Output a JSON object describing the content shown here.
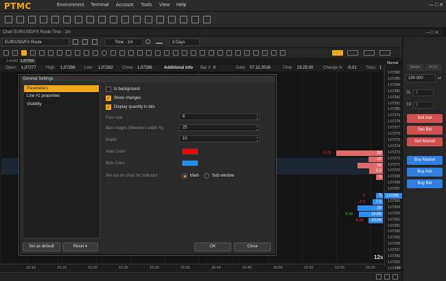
{
  "app": {
    "logo": "PTMC"
  },
  "menu": [
    "Environment",
    "Terminal",
    "Account",
    "Tools",
    "View",
    "Help"
  ],
  "window_controls": "— □ ✕",
  "chart_window": {
    "title": "Chart EUR/USD/FX Route Time - 1m",
    "controls": "— □ ✕"
  },
  "chart_toolbar": {
    "symbol": "EUR/USD/FX Route",
    "timeframe": "Time - 1m",
    "period": "3 Days",
    "level_label": "Level2"
  },
  "ohlc": {
    "open_label": "Open:",
    "open": "1,07277",
    "high_label": "High:",
    "high": "1,07286",
    "low_label": "Low:",
    "low": "1,07262",
    "close_label": "Close:",
    "close": "1,07266",
    "info": "Additional info",
    "bar_label": "Bar #:",
    "bar": "0",
    "date_label": "Date:",
    "date": "07.12.2016",
    "time_label": "Time:",
    "time": "15:25:00",
    "change_label": "Change,%",
    "change": "-0,01",
    "ticks_label": "Ticks:",
    "ticks": "1"
  },
  "level_price": "1,07266",
  "price_scale": {
    "header": "Manual",
    "ticks": [
      "1.07286",
      "1.07285",
      "1.07284",
      "1.07283",
      "1.07282",
      "1.07281",
      "1.07280",
      "1.07279",
      "1.07278",
      "1.07277",
      "1.07276",
      "1.07275",
      "1.07274",
      "1.07273",
      "1.07272",
      "1.07271",
      "1.07270",
      "1.07269",
      "1.07268",
      "1.07267",
      "1.07266",
      "1.07265",
      "1.07264",
      "1.07263",
      "1.07262",
      "1.07261",
      "1.07260",
      "1.07259",
      "1.07258",
      "1.07257",
      "1.07256",
      "1.07255",
      "1.07254"
    ],
    "current": "1.07266"
  },
  "time_axis": [
    "15:10",
    "15:15",
    "15:20",
    "15:25",
    "15:30",
    "15:35",
    "15:40",
    "15:45",
    "15:50",
    "15:55",
    "16:00",
    "16:05",
    "16:10"
  ],
  "timer": "12s",
  "depth": {
    "asks": [
      {
        "qty": "33",
        "delta": "-5.75",
        "price_index": 13
      },
      {
        "qty": "10",
        "delta": "",
        "price_index": 14
      },
      {
        "qty": "18",
        "delta": "",
        "price_index": 15
      },
      {
        "qty": "9.9",
        "delta": "",
        "price_index": 16
      },
      {
        "qty": "5",
        "delta": "",
        "price_index": 17
      }
    ],
    "bids": [
      {
        "qty": "5",
        "delta": "-2",
        "price_index": 20
      },
      {
        "qty": "7.5",
        "delta": "-2.5",
        "price_index": 21
      },
      {
        "qty": "18",
        "delta": "",
        "price_index": 22
      },
      {
        "qty": "16.89",
        "delta": "9.39",
        "price_index": 23
      },
      {
        "qty": "10.04",
        "delta": "-9.95",
        "price_index": 24
      }
    ],
    "max_qty": 33
  },
  "order_panel": {
    "tabs": [
      "Single",
      "OCO"
    ],
    "quantity": "100 000",
    "sl_label": "SL",
    "sl_value": "1",
    "tp_label": "TP",
    "tp_value": "1",
    "sell_ask": "Sell Ask",
    "sell_bid": "Sell Bid",
    "sell_market": "Sell Market",
    "buy_market": "Buy Market",
    "buy_ask": "Buy Ask",
    "buy_bid": "Buy Bid"
  },
  "dialog": {
    "title": "General Settings",
    "nav": [
      "Parameters",
      "Line #1 properties",
      "Visibility"
    ],
    "is_background": "Is background",
    "show_changes": "Show changes",
    "display_quantity": "Display quantity in lots",
    "font_size_label": "Font size",
    "font_size": "8",
    "bars_height_label": "Bars height (Window's width %)",
    "bars_height": "25",
    "depth_label": "Depth",
    "depth": "10",
    "asks_color_label": "Asks Color",
    "asks_color": "#ff0000",
    "bids_color_label": "Bids Color",
    "bids_color": "#1e90ff",
    "run_label": "We run on chart for indicator",
    "main": "Main",
    "sub_window": "Sub window",
    "set_default": "Set as default",
    "reset": "Reset",
    "ok": "OK",
    "close": "Close"
  }
}
